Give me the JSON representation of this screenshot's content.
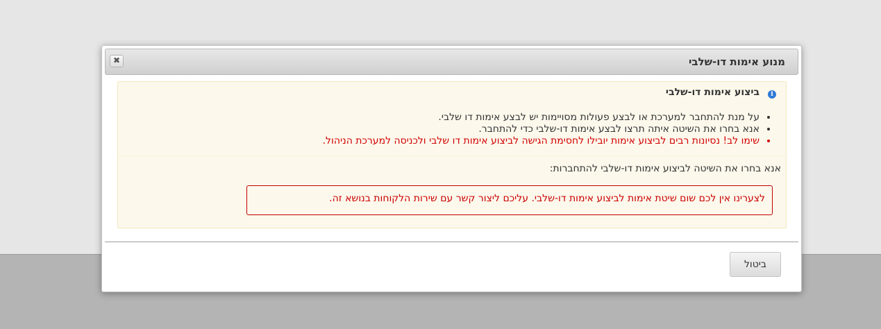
{
  "dialog": {
    "title": "מנוע אימות דו-שלבי",
    "close_icon": "close-icon",
    "close_glyph": "✖"
  },
  "panel": {
    "info_icon": "info-icon",
    "info_glyph": "i",
    "section_title": "ביצוע אימות דו-שלבי",
    "bullets": [
      "על מנת להתחבר למערכת או לבצע פעולות מסויימות יש לבצע אימות דו שלבי.",
      "אנא בחרו את השיטה איתה תרצו לבצע אימות דו-שלבי כדי להתחבר.",
      "שימו לב! נסיונות רבים לביצוע אימות יובילו לחסימת הגישה לביצוע אימות דו שלבי ולכניסה למערכת הניהול."
    ],
    "choose_label": "אנא בחרו את השיטה לביצוע אימות דו-שלבי להתחברות:",
    "error_message": "לצערינו אין לכם שום שיטת אימות לביצוע אימות דו-שלבי. עליכם ליצור קשר עם שירות הלקוחות בנושא זה."
  },
  "footer": {
    "cancel_label": "ביטול"
  },
  "colors": {
    "warning_text": "#d20000",
    "panel_background": "#fcf8ec",
    "info_icon": "#2f7ad6"
  }
}
